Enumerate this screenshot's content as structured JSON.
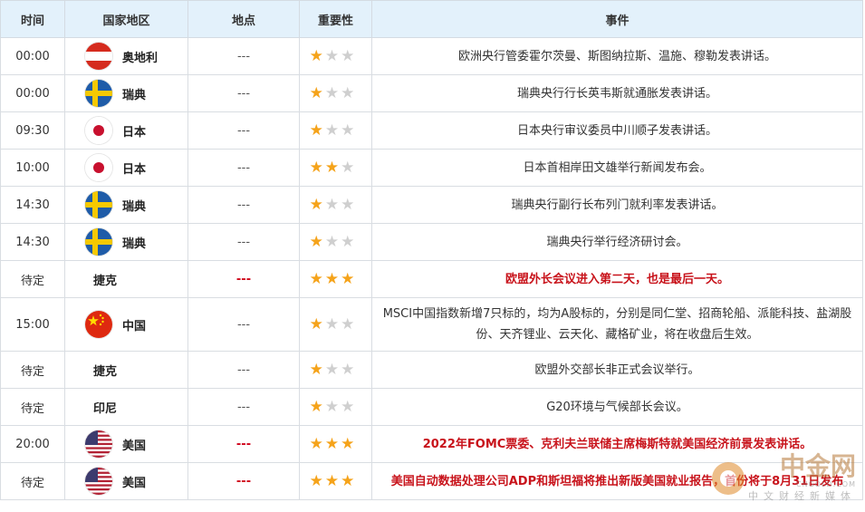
{
  "headers": {
    "time": "时间",
    "country": "国家地区",
    "location": "地点",
    "importance": "重要性",
    "event": "事件"
  },
  "rows": [
    {
      "time": "00:00",
      "country": "奥地利",
      "flag": "austria-flag",
      "location": "---",
      "importance": 1,
      "event": "欧洲央行管委霍尔茨曼、斯图纳拉斯、温施、穆勒发表讲话。"
    },
    {
      "time": "00:00",
      "country": "瑞典",
      "flag": "sweden-flag",
      "location": "---",
      "importance": 1,
      "event": "瑞典央行行长英韦斯就通胀发表讲话。"
    },
    {
      "time": "09:30",
      "country": "日本",
      "flag": "japan-flag",
      "location": "---",
      "importance": 1,
      "event": "日本央行审议委员中川顺子发表讲话。"
    },
    {
      "time": "10:00",
      "country": "日本",
      "flag": "japan-flag",
      "location": "---",
      "importance": 2,
      "event": "日本首相岸田文雄举行新闻发布会。"
    },
    {
      "time": "14:30",
      "country": "瑞典",
      "flag": "sweden-flag",
      "location": "---",
      "importance": 1,
      "event": "瑞典央行副行长布列门就利率发表讲话。"
    },
    {
      "time": "14:30",
      "country": "瑞典",
      "flag": "sweden-flag",
      "location": "---",
      "importance": 1,
      "event": "瑞典央行举行经济研讨会。"
    },
    {
      "time": "待定",
      "country": "捷克",
      "flag": "",
      "location": "---",
      "importance": 3,
      "event": "欧盟外长会议进入第二天，也是最后一天。"
    },
    {
      "time": "15:00",
      "country": "中国",
      "flag": "china-flag",
      "location": "---",
      "importance": 1,
      "event": "MSCI中国指数新增7只标的，均为A股标的，分别是同仁堂、招商轮船、派能科技、盐湖股份、天齐锂业、云天化、藏格矿业，将在收盘后生效。"
    },
    {
      "time": "待定",
      "country": "捷克",
      "flag": "",
      "location": "---",
      "importance": 1,
      "event": "欧盟外交部长非正式会议举行。"
    },
    {
      "time": "待定",
      "country": "印尼",
      "flag": "",
      "location": "---",
      "importance": 1,
      "event": "G20环境与气候部长会议。"
    },
    {
      "time": "20:00",
      "country": "美国",
      "flag": "usa-flag",
      "location": "---",
      "importance": 3,
      "event": "2022年FOMC票委、克利夫兰联储主席梅斯特就美国经济前景发表讲话。"
    },
    {
      "time": "待定",
      "country": "美国",
      "flag": "usa-flag",
      "location": "---",
      "importance": 3,
      "event": "美国自动数据处理公司ADP和斯坦福将推出新版美国就业报告，首份将于8月31日发布"
    }
  ],
  "watermark": {
    "name": "中金网",
    "url": "CNGOLD.COM",
    "tagline": "中文财经新媒体"
  },
  "colors": {
    "header_bg": "#e3f1fb",
    "highlight_red": "#c8131b",
    "star_on": "#f5a31a",
    "star_off": "#cfcfcf"
  }
}
